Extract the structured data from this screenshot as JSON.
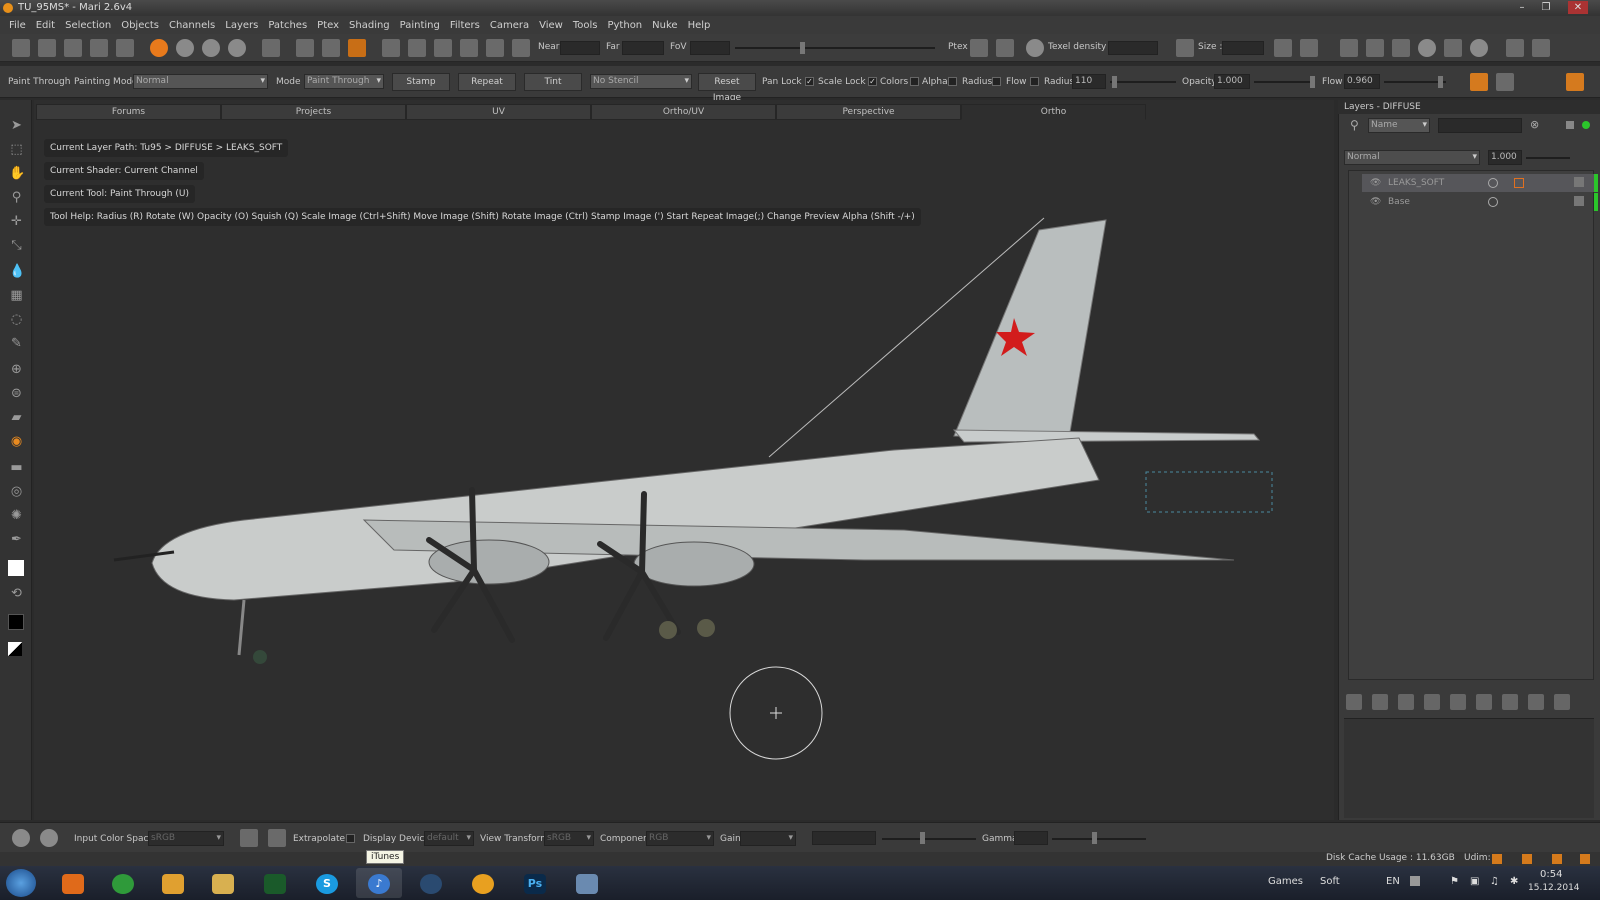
{
  "window": {
    "title": "TU_95MS* - Mari 2.6v4",
    "controls": [
      "–",
      "❐",
      "✕"
    ]
  },
  "menu": [
    "File",
    "Edit",
    "Selection",
    "Objects",
    "Channels",
    "Layers",
    "Patches",
    "Ptex",
    "Shading",
    "Painting",
    "Filters",
    "Camera",
    "View",
    "Tools",
    "Python",
    "Nuke",
    "Help"
  ],
  "toolbar": {
    "near_label": "Near",
    "far_label": "Far",
    "fov_label": "FoV",
    "ptex_label": "Ptex",
    "texel_density_label": "Texel density :",
    "size_label": "Size :"
  },
  "tool_options": {
    "paint_through": "Paint Through",
    "painting_mode_label": "Painting Mode",
    "painting_mode_value": "Normal",
    "mode_label": "Mode",
    "mode_value": "Paint Through",
    "stamp": "Stamp",
    "repeat": "Repeat",
    "tint": "Tint",
    "stencil_value": "No Stencil",
    "reset_image": "Reset Image",
    "pan_lock": "Pan Lock",
    "scale_lock": "Scale Lock",
    "colors": "Colors",
    "alpha": "Alpha",
    "radius_check": "Radius",
    "flow_check": "Flow",
    "radius_label": "Radius",
    "radius_value": "110",
    "opacity_label": "Opacity",
    "opacity_value": "1.000",
    "flow_label": "Flow",
    "flow_value": "0.960"
  },
  "tabs": [
    "Forums",
    "Projects",
    "UV",
    "Ortho/UV",
    "Perspective",
    "Ortho"
  ],
  "active_tab": "Ortho",
  "hud": {
    "layer_path": "Current Layer Path: Tu95 > DIFFUSE > LEAKS_SOFT",
    "shader": "Current Shader: Current Channel",
    "tool": "Current Tool: Paint Through (U)",
    "tool_help": "Tool Help:   Radius (R)   Rotate (W)   Opacity (O)   Squish (Q)   Scale Image (Ctrl+Shift)   Move Image (Shift)   Rotate Image (Ctrl)   Stamp Image (')   Start Repeat Image(;)   Change Preview Alpha (Shift -/+)"
  },
  "layers_panel": {
    "title": "Layers - DIFFUSE",
    "filter_field": "Name",
    "blend_mode": "Normal",
    "opacity": "1.000",
    "layers": [
      {
        "name": "LEAKS_SOFT",
        "selected": true
      },
      {
        "name": "Base",
        "selected": false
      }
    ]
  },
  "bottom_bar": {
    "input_color_space_label": "Input Color Space",
    "input_color_space_value": "sRGB",
    "extrapolate": "Extrapolate",
    "display_device_label": "Display Device",
    "display_device_value": "default",
    "view_transform_label": "View Transform",
    "view_transform_value": "sRGB",
    "component_label": "Component",
    "component_value": "RGB",
    "gain_label": "Gain",
    "gamma_label": "Gamma"
  },
  "status": {
    "disk_cache": "Disk Cache Usage : 11.63GB",
    "udim": "Udim:"
  },
  "taskbar": {
    "tooltip": "iTunes",
    "apps": [
      "firefox",
      "chrome",
      "media-player",
      "explorer",
      "terminal",
      "skype",
      "itunes",
      "steam",
      "sun-app",
      "photoshop",
      "window-app"
    ],
    "tray_games": "Games",
    "tray_soft": "Soft",
    "lang": "EN",
    "time": "0:54",
    "date": "15.12.2014"
  },
  "colors": {
    "accent": "#e87a1c",
    "panel": "#3a3a3a",
    "viewport": "#2e2e2e",
    "layer_selected": "#56565a",
    "green_tag": "#2bc52b"
  }
}
